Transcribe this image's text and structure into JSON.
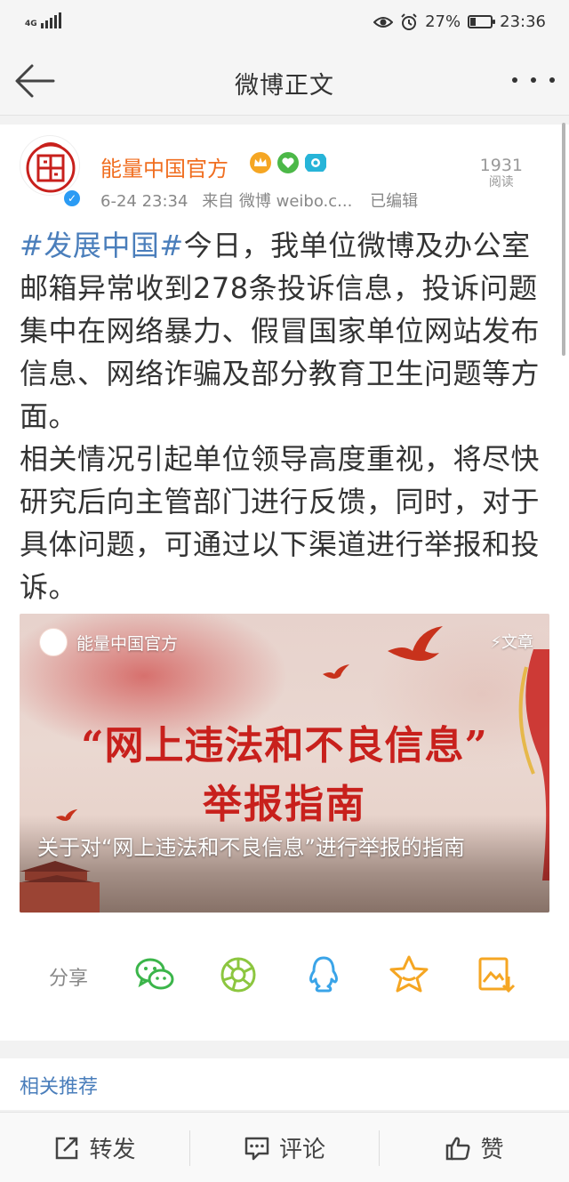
{
  "status_bar": {
    "network": "4G",
    "battery_percent": "27%",
    "battery_level": 0.27,
    "time": "23:36"
  },
  "nav": {
    "title": "微博正文"
  },
  "post": {
    "author": "能量中国官方",
    "timestamp": "6-24 23:34",
    "source": "来自 微博 weibo.c...",
    "edited": "已编辑",
    "read_count": "1931",
    "read_label": "阅读",
    "hashtag": "#发展中国#",
    "paragraph1": "今日，我单位微博及办公室邮箱异常收到278条投诉信息，投诉问题集中在网络暴力、假冒国家单位网站发布信息、网络诈骗及部分教育卫生问题等方面。",
    "paragraph2": "相关情况引起单位领导高度重视，将尽快研究后向主管部门进行反馈，同时，对于具体问题，可通过以下渠道进行举报和投诉。"
  },
  "article_card": {
    "source_name": "能量中国官方",
    "type_label": "⚡文章",
    "headline_line1": "“网上违法和不良信息”",
    "headline_line2": "举报指南",
    "title": "关于对“网上违法和不良信息”进行举报的指南"
  },
  "share": {
    "label": "分享",
    "colors": {
      "wechat": "#3bb54a",
      "moments": "#8cc63f",
      "qq": "#3aa4e8",
      "favorite": "#f5a623",
      "save": "#f5a623"
    }
  },
  "related": {
    "label": "相关推荐"
  },
  "bottom_bar": {
    "repost": "转发",
    "comment": "评论",
    "like": "赞"
  },
  "colors": {
    "username": "#f06e20",
    "link": "#4a7ebb",
    "headline_red": "#c8201c",
    "verified_blue": "#2b9bf4"
  }
}
